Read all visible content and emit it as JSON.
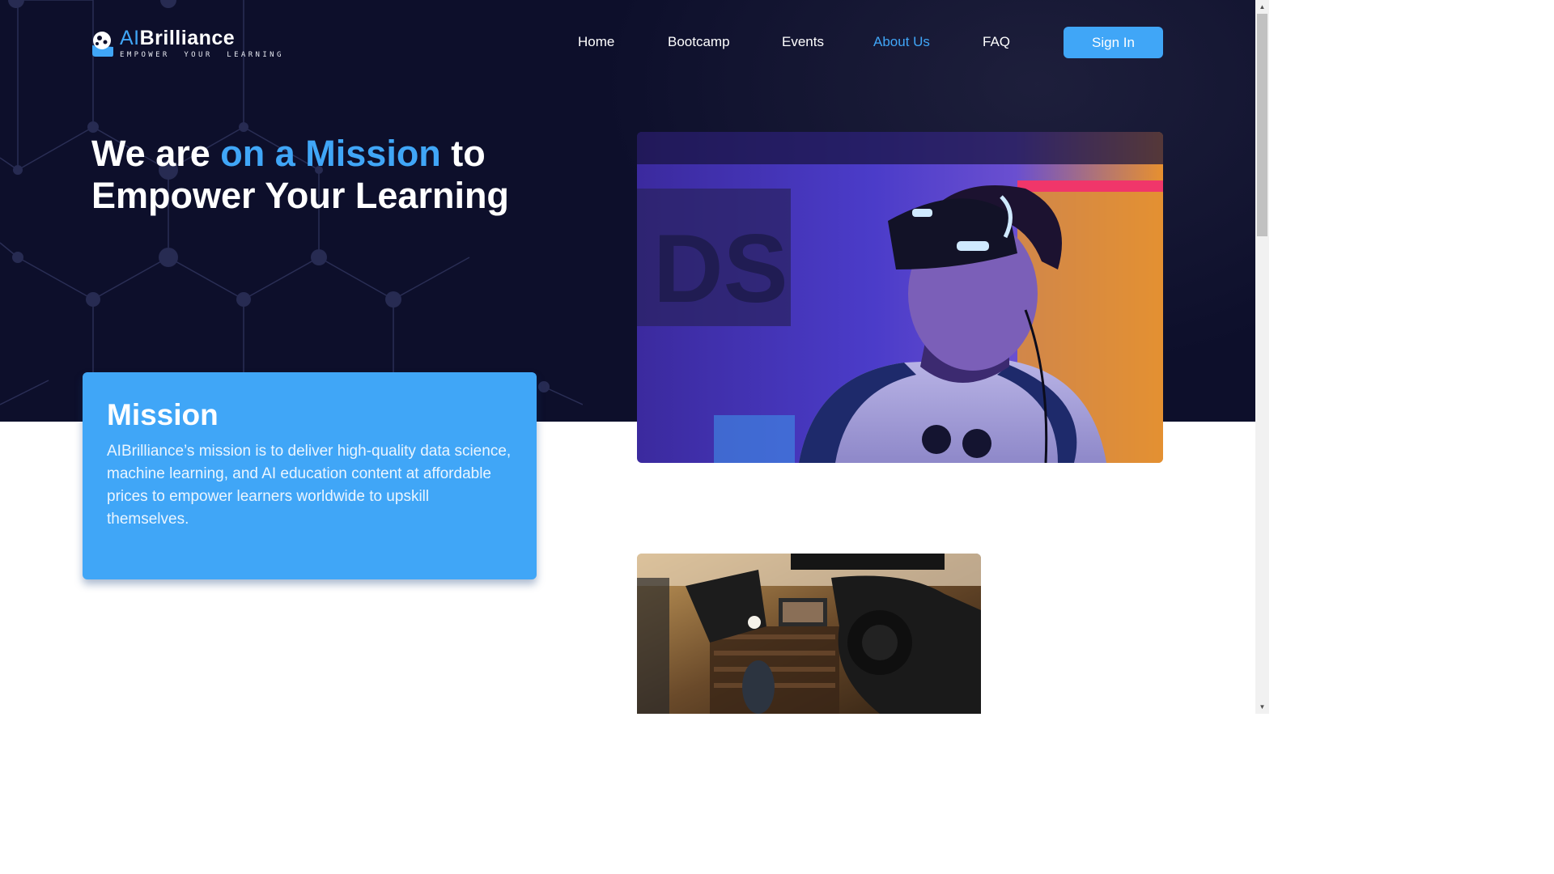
{
  "brand": {
    "name_ai": "AI",
    "name_rest": "Brilliance",
    "tagline": "EMPOWER  YOUR  LEARNING"
  },
  "nav": {
    "items": [
      {
        "label": "Home"
      },
      {
        "label": "Bootcamp"
      },
      {
        "label": "Events"
      },
      {
        "label": "About Us",
        "active": true
      },
      {
        "label": "FAQ"
      }
    ],
    "sign_in": "Sign In"
  },
  "hero": {
    "headline_before": "We are ",
    "headline_accent": "on a Mission",
    "headline_after": " to",
    "headline_line2": "Empower Your Learning"
  },
  "mission": {
    "title": "Mission",
    "body": "AIBrilliance’s mission is to deliver high-quality data science, machine learning, and AI education content at affordable prices to empower learners worldwide to upskill themselves."
  },
  "images": {
    "vr": "vr-headset-photo",
    "camera": "video-camera-photo"
  },
  "colors": {
    "accent": "#40a6f7",
    "hero_bg": "#0d0f2b",
    "text_light": "#ffffff"
  },
  "icons": {
    "scroll_up": "▲",
    "scroll_down": "▼"
  }
}
